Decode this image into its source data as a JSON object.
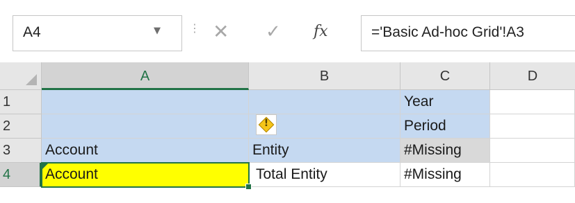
{
  "formula_bar": {
    "name_box_value": "A4",
    "name_box_arrow": "▼",
    "separator": "⋮",
    "cancel_glyph": "✕",
    "enter_glyph": "✓",
    "fx_label": "fx",
    "formula_text": "='Basic Ad-hoc Grid'!A3"
  },
  "grid": {
    "columns": [
      "A",
      "B",
      "C",
      "D"
    ],
    "rows": [
      "1",
      "2",
      "3",
      "4"
    ],
    "active_cell": "A4",
    "cells": {
      "A1": "",
      "B1": "",
      "C1": "Year",
      "D1": "",
      "A2": "",
      "B2": "",
      "C2": "Period",
      "D2": "",
      "A3": "Account",
      "B3": "Entity",
      "C3": "#Missing",
      "D3": "",
      "A4": "Account",
      "B4": "Total Entity",
      "C4": "#Missing",
      "D4": ""
    }
  },
  "icons": {
    "dropdown": "chevron-down-icon",
    "cancel": "close-icon",
    "enter": "checkmark-icon",
    "insert_function": "function-icon",
    "error_check": "warning-icon"
  },
  "colors": {
    "header_blue": "#c5d9f1",
    "missing_grey": "#d9d9d9",
    "highlight_yellow": "#ffff00",
    "selection_green": "#217346"
  }
}
